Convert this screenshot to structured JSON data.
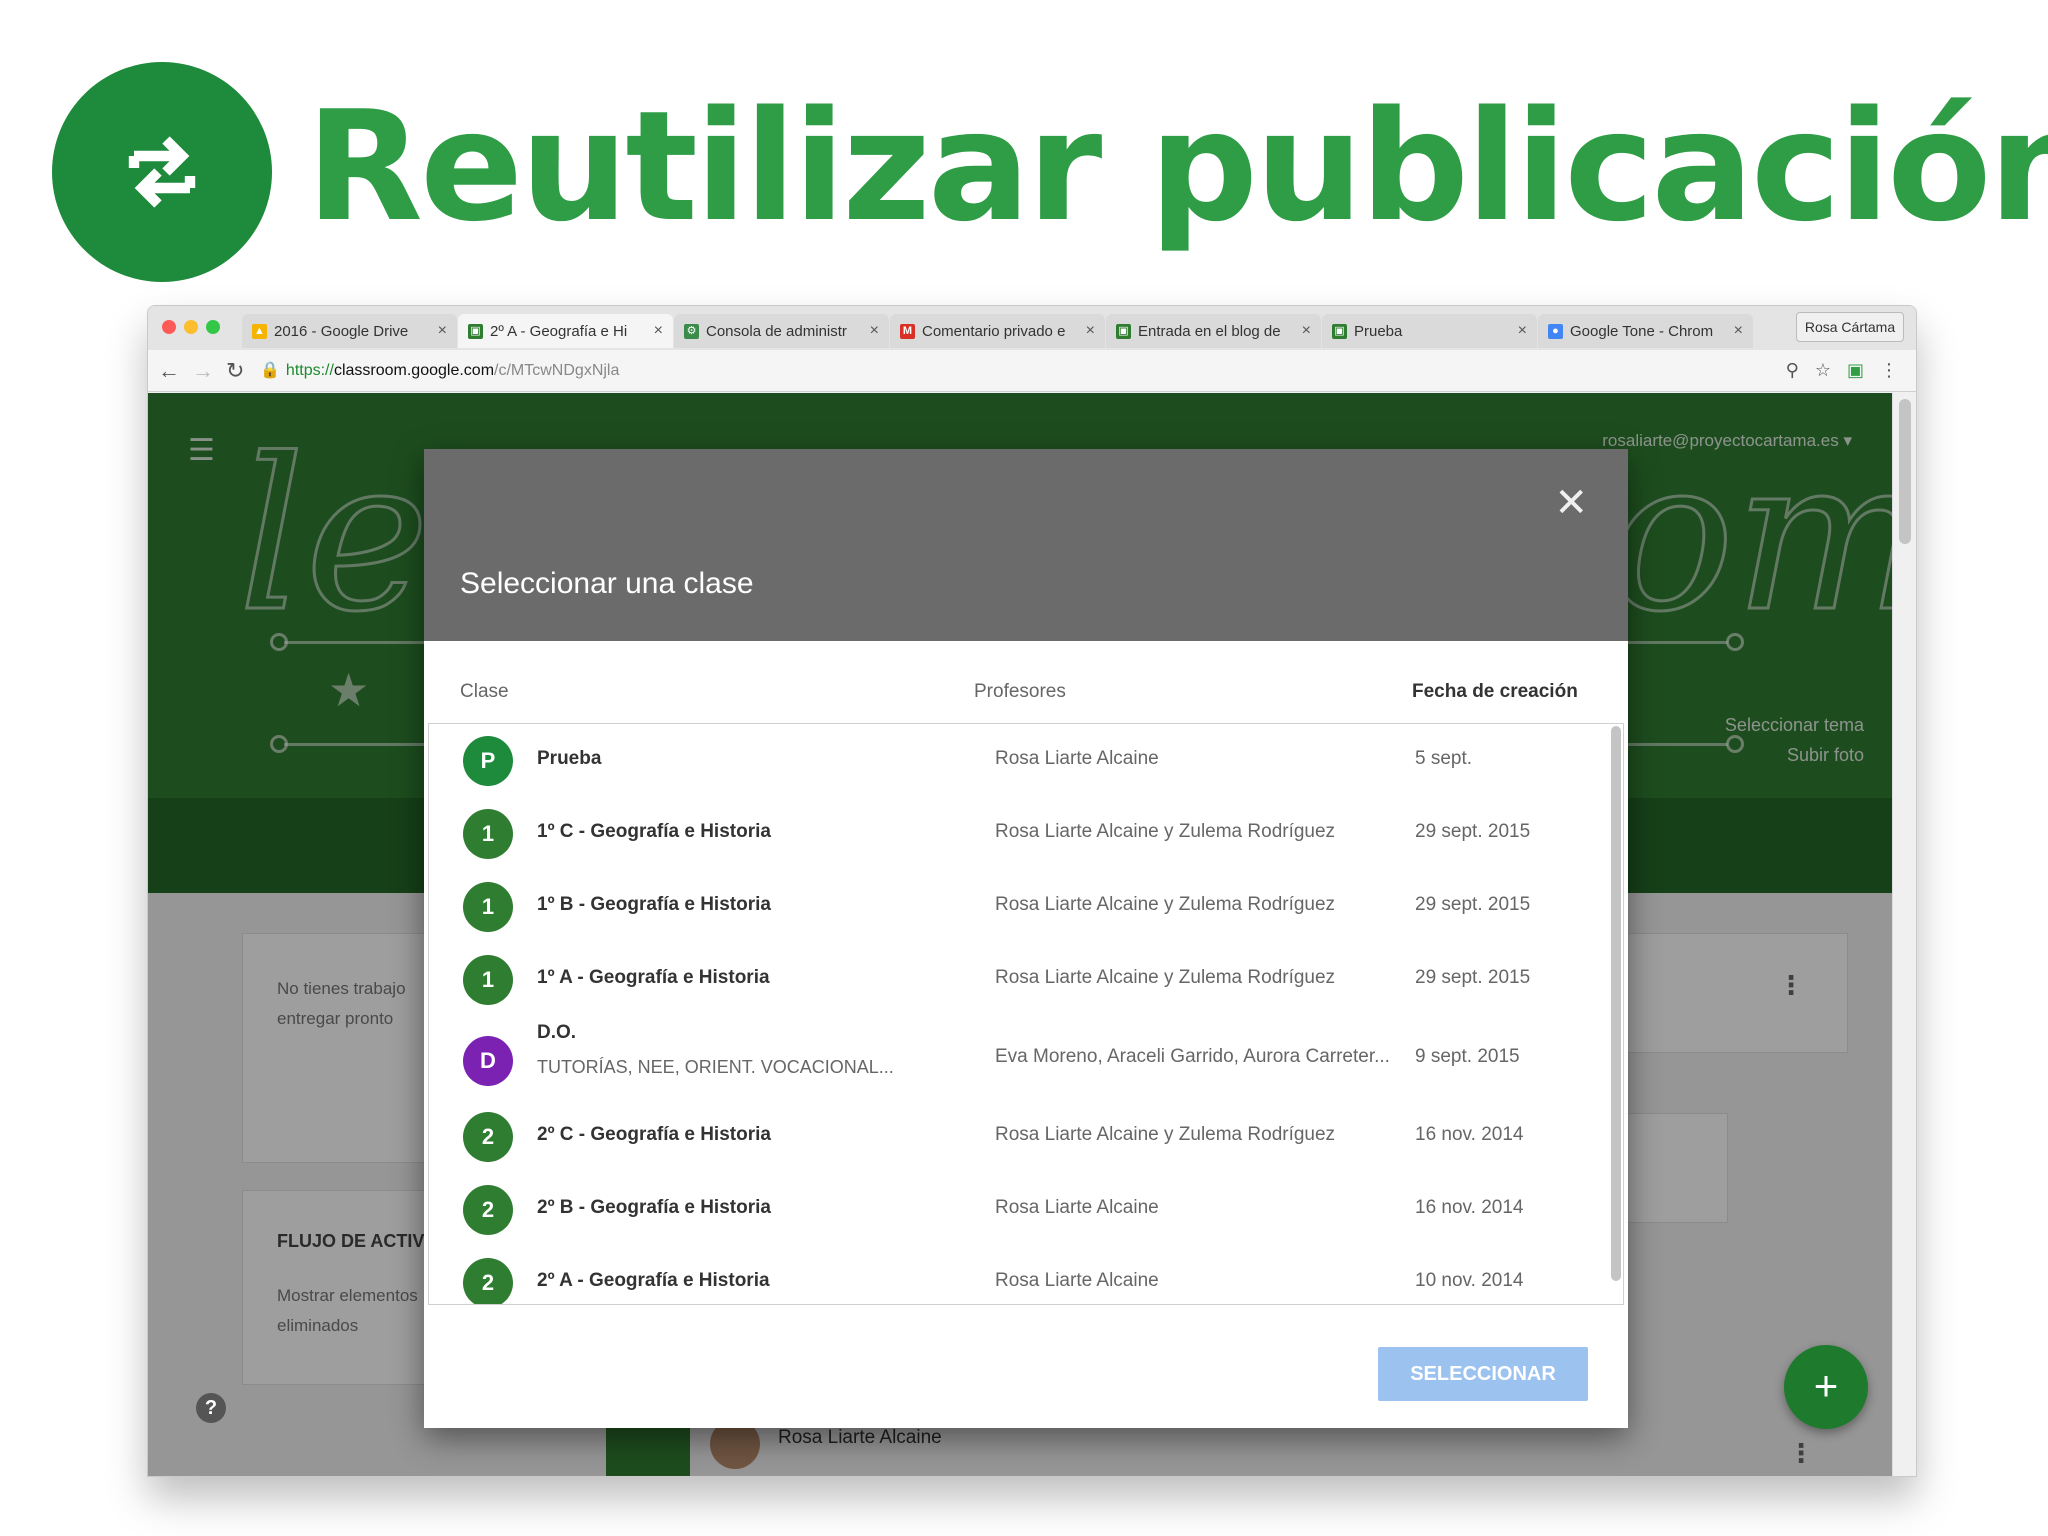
{
  "hero": {
    "title": "Reutilizar publicación",
    "icon": "reuse-swap-icon",
    "badge_color": "#1e8a3c",
    "title_color": "#2e9d46"
  },
  "browser": {
    "tabs": [
      {
        "label": "2016 - Google Drive",
        "icon": "google-drive-icon",
        "active": false
      },
      {
        "label": "2º A - Geografía e Hi",
        "icon": "classroom-icon",
        "active": true
      },
      {
        "label": "Consola de administr",
        "icon": "admin-console-icon",
        "active": false
      },
      {
        "label": "Comentario privado e",
        "icon": "gmail-icon",
        "active": false
      },
      {
        "label": "Entrada en el blog de",
        "icon": "classroom-icon",
        "active": false
      },
      {
        "label": "Prueba",
        "icon": "classroom-icon",
        "active": false
      },
      {
        "label": "Google Tone - Chrom",
        "icon": "chrome-store-icon",
        "active": false
      }
    ],
    "profile": "Rosa Cártama",
    "url": {
      "scheme": "https://",
      "host": "classroom.google.com",
      "path": "/c/MTcwNDgxNjla"
    }
  },
  "classroom": {
    "user_email": "rosaliarte@proyectocartama.es",
    "header_links": [
      "Seleccionar tema",
      "Subir foto"
    ],
    "upcoming_text": [
      "No tienes trabajo",
      "entregar pronto"
    ],
    "stream_title": "FLUJO DE ACTIV",
    "stream_text": [
      "Mostrar elementos",
      "eliminados"
    ],
    "post_author": "Rosa Liarte Alcaine",
    "fab_label": "+",
    "help_label": "?",
    "header_color": "#2f7d31"
  },
  "dialog": {
    "title": "Seleccionar una clase",
    "columns": {
      "class": "Clase",
      "teachers": "Profesores",
      "date": "Fecha de creación"
    },
    "rows": [
      {
        "initial": "P",
        "color": "#1e8a3c",
        "name": "Prueba",
        "subtitle": "",
        "teachers": "Rosa Liarte Alcaine",
        "date": "5 sept."
      },
      {
        "initial": "1",
        "color": "#2f7d31",
        "name": "1º C - Geografía e Historia",
        "subtitle": "",
        "teachers": "Rosa Liarte Alcaine y Zulema Rodríguez",
        "date": "29 sept. 2015"
      },
      {
        "initial": "1",
        "color": "#2f7d31",
        "name": "1º B - Geografía e Historia",
        "subtitle": "",
        "teachers": "Rosa Liarte Alcaine y Zulema Rodríguez",
        "date": "29 sept. 2015"
      },
      {
        "initial": "1",
        "color": "#2f7d31",
        "name": "1º A - Geografía e Historia",
        "subtitle": "",
        "teachers": "Rosa Liarte Alcaine y Zulema Rodríguez",
        "date": "29 sept. 2015"
      },
      {
        "initial": "D",
        "color": "#7b22b3",
        "name": "D.O.",
        "subtitle": "TUTORÍAS, NEE, ORIENT. VOCACIONAL...",
        "teachers": "Eva Moreno, Araceli Garrido, Aurora Carreter...",
        "date": "9 sept. 2015"
      },
      {
        "initial": "2",
        "color": "#2f7d31",
        "name": "2º C - Geografía e Historia",
        "subtitle": "",
        "teachers": "Rosa Liarte Alcaine y Zulema Rodríguez",
        "date": "16 nov. 2014"
      },
      {
        "initial": "2",
        "color": "#2f7d31",
        "name": "2º B - Geografía e Historia",
        "subtitle": "",
        "teachers": "Rosa Liarte Alcaine",
        "date": "16 nov. 2014"
      },
      {
        "initial": "2",
        "color": "#2f7d31",
        "name": "2º A - Geografía e Historia",
        "subtitle": "",
        "teachers": "Rosa Liarte Alcaine",
        "date": "10 nov. 2014"
      }
    ],
    "select_label": "SELECCIONAR",
    "select_color": "#9cc3f0"
  }
}
